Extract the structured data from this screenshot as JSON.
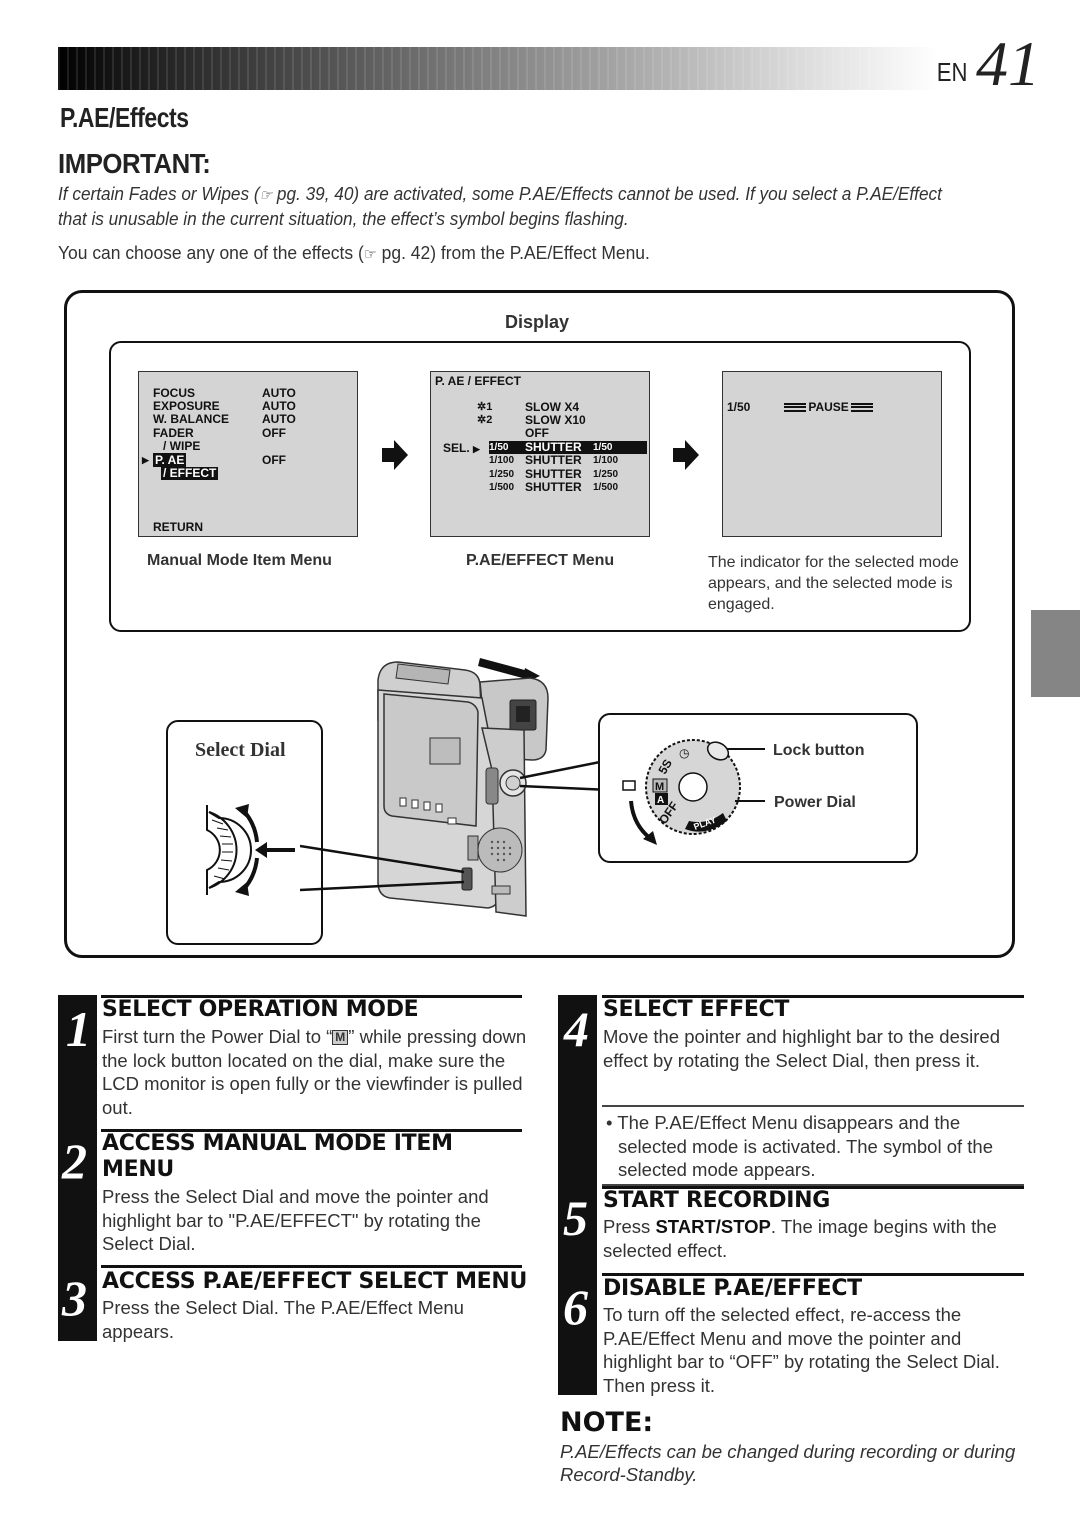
{
  "header": {
    "language": "EN",
    "page_number": "41"
  },
  "section_title": "P.AE/Effects",
  "important": {
    "title": "IMPORTANT:",
    "text_part1": "If certain Fades or Wipes (",
    "ref_icon": "pointing-hand-icon",
    "text_part2": " pg. 39, 40) are activated, some P.AE/Effects cannot be used. If you select a P.AE/Effect that is unusable in the current situation, the effect’s symbol begins flashing."
  },
  "intro": {
    "text_part1": "You can choose any one of the effects (",
    "text_part2": " pg. 42) from the P.AE/Effect Menu."
  },
  "display": {
    "label": "Display",
    "manual_menu": {
      "caption": "Manual Mode Item Menu",
      "rows": [
        {
          "label": "FOCUS",
          "value": "AUTO"
        },
        {
          "label": "EXPOSURE",
          "value": "AUTO"
        },
        {
          "label": "W. BALANCE",
          "value": "AUTO"
        },
        {
          "label": "FADER",
          "value": "OFF"
        },
        {
          "label": "/ WIPE",
          "value": ""
        },
        {
          "label": "P. AE",
          "value": "OFF"
        },
        {
          "label": "/ EFFECT",
          "value": ""
        }
      ],
      "return_label": "RETURN"
    },
    "effect_menu": {
      "caption": "P.AE/EFFECT Menu",
      "title": "P. AE / EFFECT",
      "sel_label": "SEL.",
      "rows": [
        {
          "icon": "✲1",
          "prefix": "",
          "name": "SLOW X4",
          "suffix": ""
        },
        {
          "icon": "✲2",
          "prefix": "",
          "name": "SLOW X10",
          "suffix": ""
        },
        {
          "icon": "",
          "prefix": "",
          "name": "OFF",
          "suffix": ""
        },
        {
          "icon": "",
          "prefix": "1/50",
          "name": "SHUTTER",
          "suffix": "1/50",
          "selected": true
        },
        {
          "icon": "",
          "prefix": "1/100",
          "name": "SHUTTER",
          "suffix": "1/100"
        },
        {
          "icon": "",
          "prefix": "1/250",
          "name": "SHUTTER",
          "suffix": "1/250"
        },
        {
          "icon": "",
          "prefix": "1/500",
          "name": "SHUTTER",
          "suffix": "1/500"
        }
      ]
    },
    "result_screen": {
      "indicator": "1/50",
      "status": "PAUSE",
      "caption": "The indicator for the selected mode appears, and the selected mode is engaged."
    }
  },
  "illustration": {
    "select_dial_label": "Select Dial",
    "lock_button_label": "Lock button",
    "power_dial_label": "Power Dial",
    "dial_markings": [
      "5S",
      "M",
      "A",
      "OFF",
      "PLAY"
    ]
  },
  "steps": [
    {
      "number": "1",
      "title": "SELECT OPERATION MODE",
      "body_part1": "First turn the Power Dial to “",
      "body_symbol": "M",
      "body_part2": "” while pressing down the lock button located on the dial, make sure the LCD monitor is open fully or the viewfinder is pulled out."
    },
    {
      "number": "2",
      "title_line1": "ACCESS MANUAL MODE ITEM",
      "title_line2": "MENU",
      "body": "Press the Select Dial and move the pointer and highlight bar to \"P.AE/EFFECT\" by rotating the Select Dial."
    },
    {
      "number": "3",
      "title": "ACCESS P.AE/EFFECT SELECT MENU",
      "body": "Press the Select Dial. The P.AE/Effect Menu appears."
    },
    {
      "number": "4",
      "title": "SELECT EFFECT",
      "body": "Move the pointer and highlight bar to the desired effect by rotating the Select Dial, then press it.",
      "bullet": "The P.AE/Effect Menu disappears and the selected mode is activated. The symbol of the selected mode appears."
    },
    {
      "number": "5",
      "title": "START RECORDING",
      "body_pre": "Press ",
      "body_bold": "START/STOP",
      "body_post": ". The image begins with the selected effect."
    },
    {
      "number": "6",
      "title": "DISABLE P.AE/EFFECT",
      "body": "To turn off the selected effect, re-access the P.AE/Effect Menu and move the pointer and highlight bar to “OFF” by rotating the Select Dial. Then press it."
    }
  ],
  "note": {
    "title": "NOTE:",
    "text": "P.AE/Effects can be changed during recording or during Record-Standby."
  }
}
